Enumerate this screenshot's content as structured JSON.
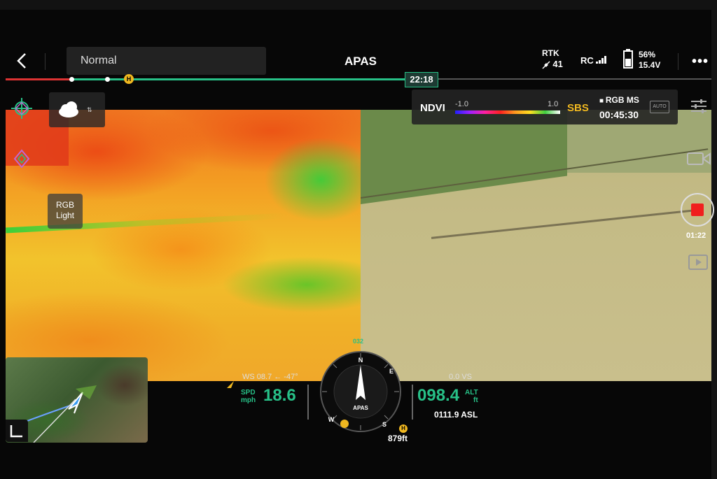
{
  "topbar": {
    "mode": "Normal",
    "app_title": "APAS",
    "rtk_label": "RTK",
    "rtk_satellites": "41",
    "rc_label": "RC",
    "battery_percent": "56%",
    "battery_voltage": "15.4V"
  },
  "timeline": {
    "current_time": "22:18",
    "home_marker": "H"
  },
  "video": {
    "rgb_light_line1": "RGB",
    "rgb_light_line2": "Light"
  },
  "ndvi": {
    "label": "NDVI",
    "min": "-1.0",
    "max": "1.0",
    "display_mode": "SBS",
    "record_mode": "RGB MS",
    "remaining_time": "00:45:30",
    "camera_mode": "AUTO"
  },
  "recording": {
    "elapsed": "01:22"
  },
  "flight": {
    "wind": "WS 08.7 ← -47°",
    "vertical_speed": "0.0  VS",
    "speed_label_1": "SPD",
    "speed_label_2": "mph",
    "speed": "18.6",
    "altitude": "098.4",
    "alt_label_1": "ALT",
    "alt_label_2": "ft",
    "asl": "0111.9 ASL",
    "home_distance": "879ft",
    "compass_label": "APAS",
    "heading_marker": "032"
  },
  "colors": {
    "accent_green": "#27c087",
    "warning_yellow": "#f0b820",
    "record_red": "#f01e1e"
  },
  "icons": [
    "back-icon",
    "satellite-icon",
    "signal-bars-icon",
    "battery-icon",
    "more-icon",
    "aim-icon",
    "diamond-icon",
    "weather-cloud-icon",
    "settings-sliders-icon",
    "video-camera-icon",
    "record-icon",
    "playback-icon",
    "map-expand-icon",
    "drone-arrow-icon"
  ]
}
